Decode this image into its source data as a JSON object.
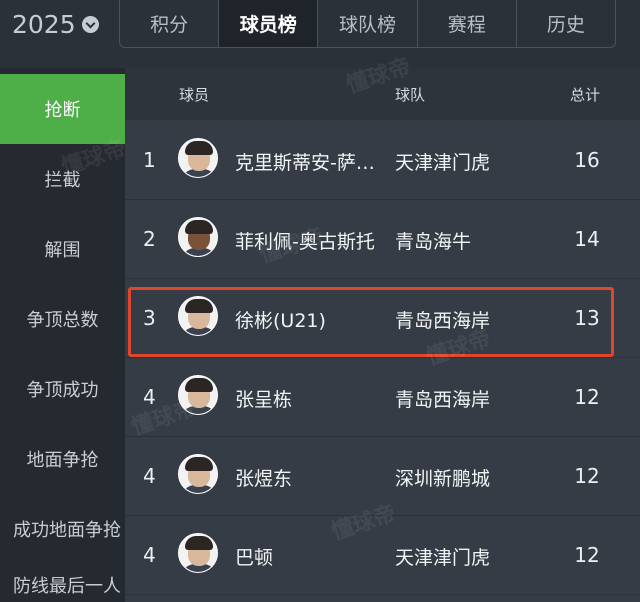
{
  "season": {
    "year": "2025"
  },
  "tabs": [
    {
      "label": "积分",
      "active": false
    },
    {
      "label": "球员榜",
      "active": true
    },
    {
      "label": "球队榜",
      "active": false
    },
    {
      "label": "赛程",
      "active": false
    },
    {
      "label": "历史",
      "active": false
    }
  ],
  "sidebar": {
    "items": [
      {
        "label": "抢断",
        "active": true
      },
      {
        "label": "拦截",
        "active": false
      },
      {
        "label": "解围",
        "active": false
      },
      {
        "label": "争顶总数",
        "active": false
      },
      {
        "label": "争顶成功",
        "active": false
      },
      {
        "label": "地面争抢",
        "active": false
      },
      {
        "label": "成功地面争抢",
        "active": false
      },
      {
        "label": "防线最后一人",
        "active": false
      }
    ]
  },
  "table": {
    "headers": {
      "player": "球员",
      "team": "球队",
      "total": "总计"
    },
    "rows": [
      {
        "rank": "1",
        "player": "克里斯蒂安-萨…",
        "team": "天津津门虎",
        "total": "16"
      },
      {
        "rank": "2",
        "player": "菲利佩-奥古斯托",
        "team": "青岛海牛",
        "total": "14"
      },
      {
        "rank": "3",
        "player": "徐彬(U21)",
        "team": "青岛西海岸",
        "total": "13"
      },
      {
        "rank": "4",
        "player": "张呈栋",
        "team": "青岛西海岸",
        "total": "12"
      },
      {
        "rank": "4",
        "player": "张煜东",
        "team": "深圳新鹏城",
        "total": "12"
      },
      {
        "rank": "4",
        "player": "巴顿",
        "team": "天津津门虎",
        "total": "12"
      }
    ]
  },
  "watermark": "懂球帝",
  "colors": {
    "accent_green": "#4eae48",
    "highlight_red": "#e0462c"
  }
}
